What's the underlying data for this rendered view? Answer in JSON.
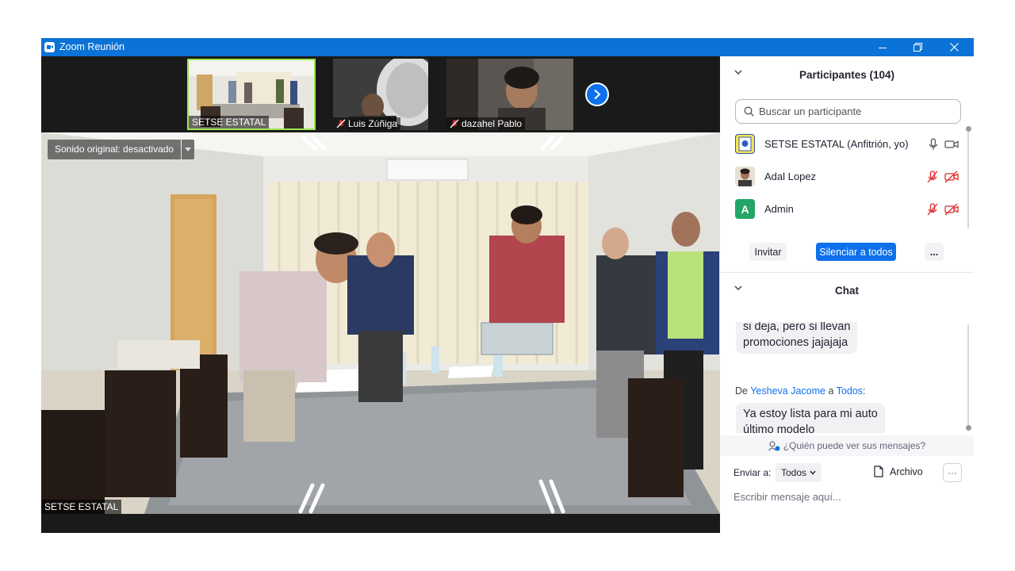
{
  "window": {
    "title": "Zoom Reunión",
    "controls": [
      "minimize-icon",
      "restore-icon",
      "close-icon"
    ]
  },
  "video": {
    "thumbnails": [
      {
        "label": "SETSE ESTATAL",
        "muted": false,
        "active_speaker": true
      },
      {
        "label": "Luis Zúñiga",
        "muted": true,
        "active_speaker": false
      },
      {
        "label": "dazahel Pablo",
        "muted": true,
        "active_speaker": false
      }
    ],
    "sound_original_label": "Sonido original: desactivado",
    "main_speaker_label": "SETSE ESTATAL"
  },
  "participants": {
    "header": "Participantes (104)",
    "search_placeholder": "Buscar un participante",
    "items": [
      {
        "name": "SETSE ESTATAL (Anfitrión, yo)",
        "avatar": "image",
        "mic": "on",
        "video": "on"
      },
      {
        "name": "Adal Lopez",
        "avatar": "photo",
        "mic": "off",
        "video": "off"
      },
      {
        "name": "Admin",
        "avatar": "A",
        "avatar_color": "#23a566",
        "mic": "off",
        "video": "off"
      }
    ],
    "invite_label": "Invitar",
    "mute_all_label": "Silenciar a todos",
    "more_label": "..."
  },
  "chat": {
    "header": "Chat",
    "messages": [
      {
        "lines": [
          "si deja, pero si llevan",
          "promociones jajajaja"
        ]
      },
      {
        "from_prefix": "De",
        "from": "Yesheva Jacome",
        "to_prefix": "a",
        "to": "Todos",
        "lines": [
          "Ya estoy lista para mi auto",
          "último modelo"
        ]
      }
    ],
    "who_sees": "¿Quién puede ver sus mensajes?",
    "send_to_label": "Enviar a:",
    "send_to_value": "Todos",
    "file_label": "Archivo",
    "more_label": "···",
    "input_placeholder": "Escribir mensaje aquí..."
  },
  "colors": {
    "titlebar": "#0b72d7",
    "accent": "#0e71eb",
    "active_border": "#9be650",
    "muted_red": "#e02828"
  }
}
